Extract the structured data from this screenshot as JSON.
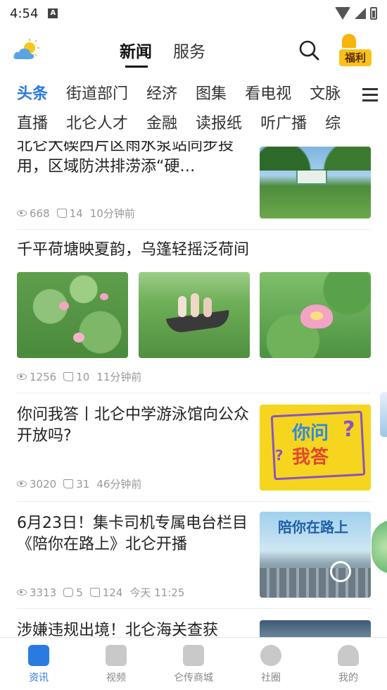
{
  "status_bar": {
    "time": "4:54"
  },
  "header": {
    "tabs": [
      {
        "label": "新闻",
        "active": true
      },
      {
        "label": "服务",
        "active": false
      }
    ],
    "welfare_label": "福利"
  },
  "categories": {
    "row1": [
      "头条",
      "街道部门",
      "经济",
      "图集",
      "看电视",
      "文脉"
    ],
    "row2": [
      "直播",
      "北仑人才",
      "金融",
      "读报纸",
      "听广播",
      "综"
    ],
    "active": "头条"
  },
  "feed": [
    {
      "title": "北仑大碶西片区雨水泵站同步投用，区域防洪排涝添“硬…",
      "views": "668",
      "likes": "14",
      "time": "10分钟前"
    },
    {
      "title": "千平荷塘映夏韵，乌篷轻摇泛荷间",
      "views": "1256",
      "likes": "10",
      "time": "11分钟前"
    },
    {
      "title": "你问我答丨北仑中学游泳馆向公众开放吗?",
      "views": "3020",
      "likes": "31",
      "time": "46分钟前",
      "image_text": [
        "你问",
        "?",
        "?",
        "我答"
      ]
    },
    {
      "title": "6月23日！集卡司机专属电台栏目《陪你在路上》北仑开播",
      "views": "3313",
      "comments": "5",
      "likes": "124",
      "time": "今天  11:25",
      "image_text": "陪你在路上"
    },
    {
      "title": "涉嫌违规出境！北仑海关查获"
    }
  ],
  "bottom_nav": [
    {
      "label": "资讯",
      "active": true
    },
    {
      "label": "视频",
      "active": false
    },
    {
      "label": "仑传商城",
      "active": false
    },
    {
      "label": "社圈",
      "active": false
    },
    {
      "label": "我的",
      "active": false
    }
  ],
  "colors": {
    "accent": "#2a7ae2",
    "welfare": "#f9c21a"
  }
}
